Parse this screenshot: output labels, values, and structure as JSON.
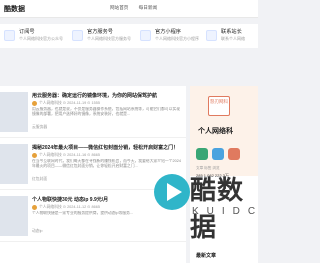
{
  "header": {
    "logo": "酷数据",
    "nav": [
      "网站首页",
      "每日新闻"
    ]
  },
  "services": [
    {
      "title": "订阅号",
      "sub": "个人网络科技官方公众号"
    },
    {
      "title": "官方服务号",
      "sub": "个人网络科技官方服务号"
    },
    {
      "title": "官方小程序",
      "sub": "个人网络科技官方小程序"
    },
    {
      "title": "联系站长",
      "sub": "联系个人网络"
    }
  ],
  "feed": [
    {
      "title": "用云服务器：确定运行的镜像环境，为你的网站保驾护航",
      "meta": "个人网络科技 ⊙ 2024-11-19 ⊙ 1555",
      "desc": "用云服务器，也就是说，不仅是服务器操作系统，包括网站系统等，可能它们都可以实现镜像的部署，把用户选择好的镜像，系统安装好，也就是...",
      "tag": "云服务器"
    },
    {
      "title": "揭秘2024年最火项目——微信红包封面分销，轻松开启财富之门！",
      "meta": "个人网络科技 ⊙ 2024-11-16 ⊙ 8665",
      "desc": "在当今互联网时代，我们每天都在寻找新的赚钱机会，而今天，我要给大家介绍一个2024年最火的项目——微信红包封面分销，让你轻松开启财富之门...",
      "tag": "红包封面"
    },
    {
      "title": "个人物联快捷30元 动态ip 9.9元/月",
      "meta": "个人网络科技 ⊙ 2024-11-12 ⊙ 8665",
      "desc": "个人物联快捷是一家专业的服务提供商，提供动态ip等服务...",
      "tag": "动态ip"
    }
  ],
  "sidebar": {
    "badge": "怒刃网科",
    "name": "个人网络科",
    "stats": "文章  标签  浏览",
    "stat_values": "285  1,082  222.3万",
    "section": "最新文章"
  },
  "watermark": {
    "text": "酷数据",
    "sub": "KUIDC"
  }
}
